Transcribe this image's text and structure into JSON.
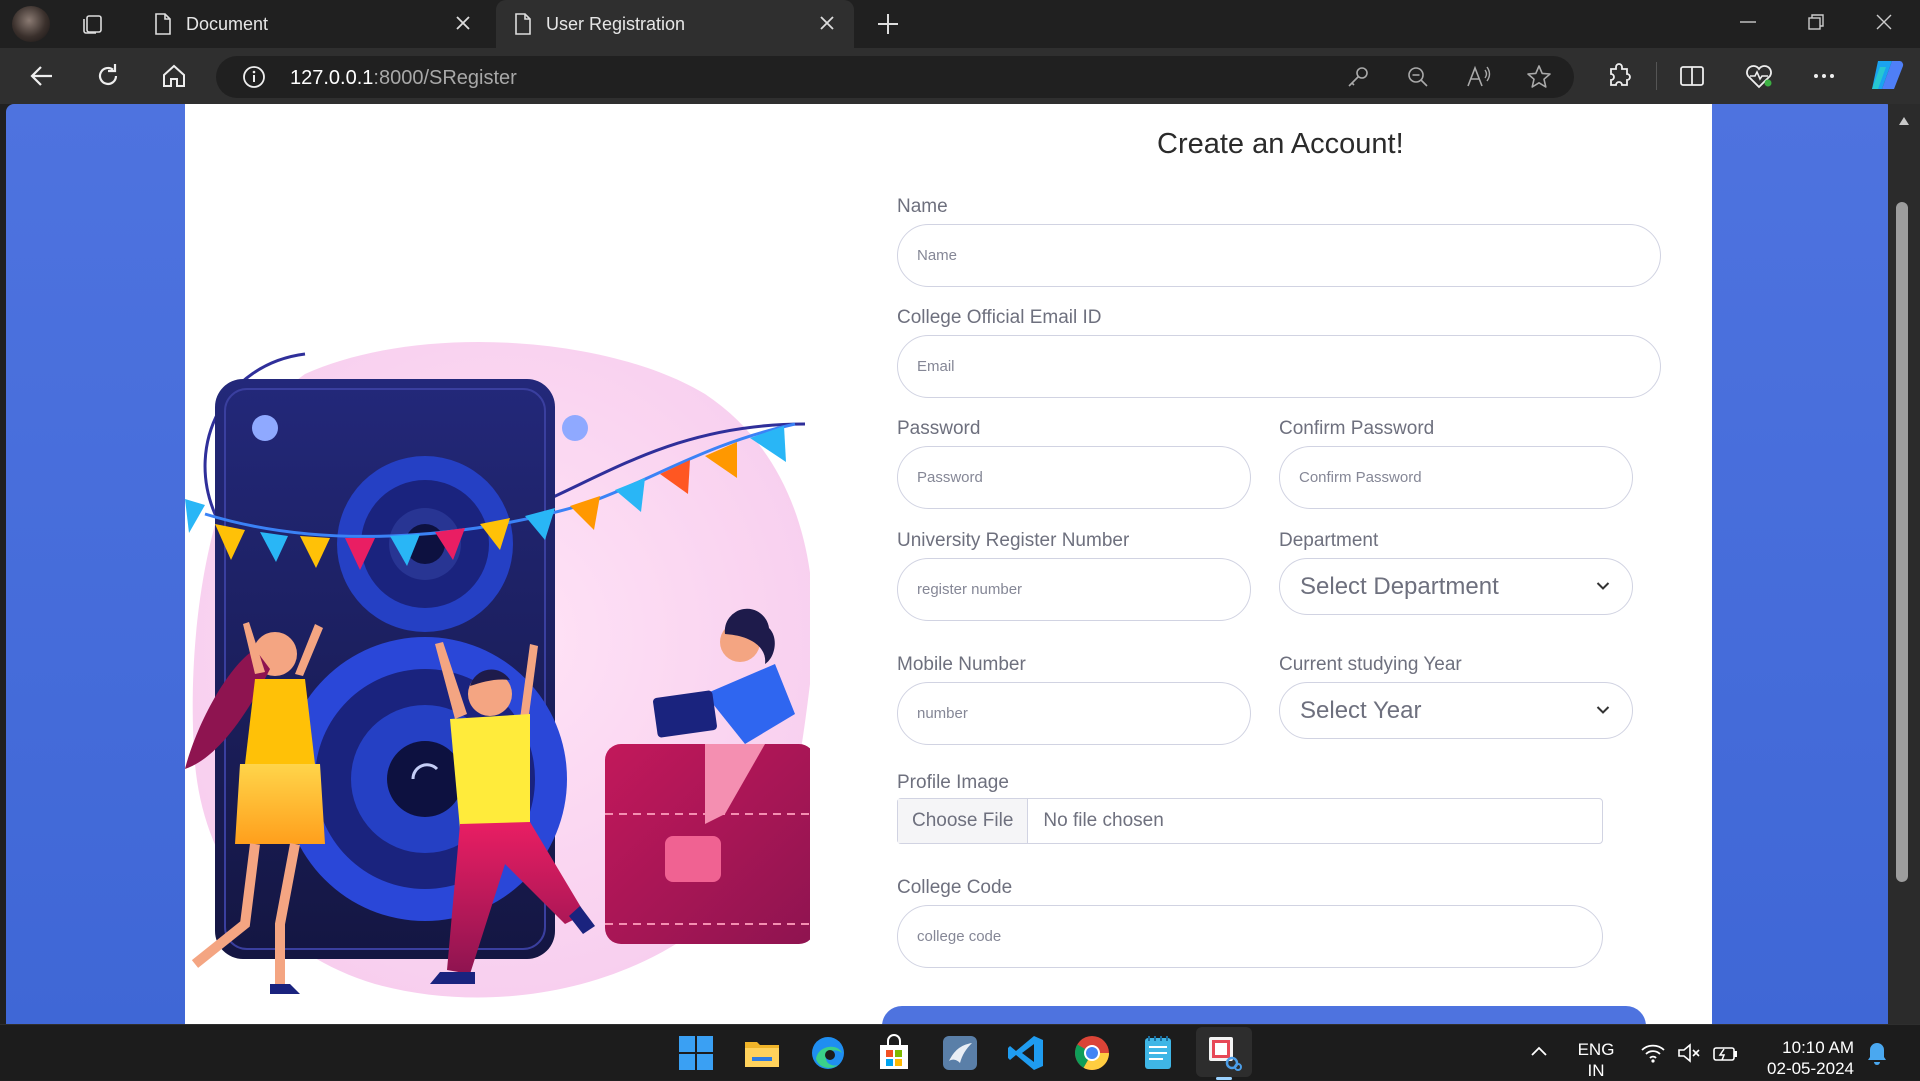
{
  "browser": {
    "tabs": [
      {
        "title": "Document",
        "active": false
      },
      {
        "title": "User Registration",
        "active": true
      }
    ],
    "url": {
      "host": "127.0.0.1",
      "rest": ":8000/SRegister"
    }
  },
  "form": {
    "title": "Create an Account!",
    "name": {
      "label": "Name",
      "placeholder": "Name"
    },
    "email": {
      "label": "College Official Email ID",
      "placeholder": "Email"
    },
    "password": {
      "label": "Password",
      "placeholder": "Password"
    },
    "confirm_password": {
      "label": "Confirm Password",
      "placeholder": "Confirm Password"
    },
    "register_number": {
      "label": "University Register Number",
      "placeholder": "register number"
    },
    "department": {
      "label": "Department",
      "selected": "Select Department"
    },
    "mobile": {
      "label": "Mobile Number",
      "placeholder": "number"
    },
    "year": {
      "label": "Current studying Year",
      "selected": "Select Year"
    },
    "profile_image": {
      "label": "Profile Image",
      "button": "Choose File",
      "status": "No file chosen"
    },
    "college_code": {
      "label": "College Code",
      "placeholder": "college code"
    }
  },
  "taskbar": {
    "language": {
      "line1": "ENG",
      "line2": "IN"
    },
    "time": "10:10 AM",
    "date": "02-05-2024"
  },
  "colors": {
    "primary": "#4e73df",
    "chrome_dark": "#202020",
    "tab_active": "#2f2f2f"
  }
}
